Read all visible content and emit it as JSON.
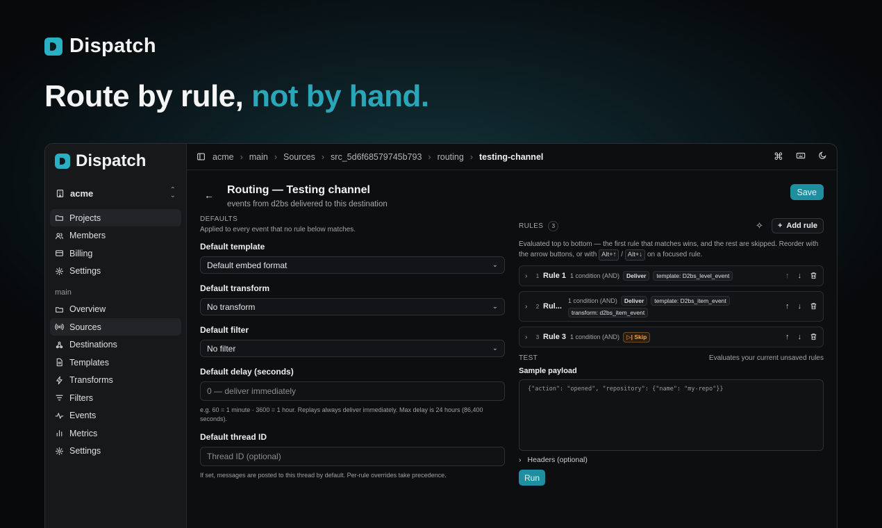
{
  "brand": {
    "name": "Dispatch"
  },
  "hero": {
    "title_main": "Route by rule, ",
    "title_accent": "not by hand."
  },
  "sidebar": {
    "org": "acme",
    "nav_top": [
      {
        "label": "Projects",
        "icon": "folder-icon",
        "active": true
      },
      {
        "label": "Members",
        "icon": "users-icon"
      },
      {
        "label": "Billing",
        "icon": "credit-card-icon"
      },
      {
        "label": "Settings",
        "icon": "gear-icon"
      }
    ],
    "section_label": "main",
    "nav_main": [
      {
        "label": "Overview",
        "icon": "folder-icon"
      },
      {
        "label": "Sources",
        "icon": "radio-icon",
        "active": true
      },
      {
        "label": "Destinations",
        "icon": "webhook-icon"
      },
      {
        "label": "Templates",
        "icon": "file-icon"
      },
      {
        "label": "Transforms",
        "icon": "bolt-icon"
      },
      {
        "label": "Filters",
        "icon": "filter-icon"
      },
      {
        "label": "Events",
        "icon": "activity-icon"
      },
      {
        "label": "Metrics",
        "icon": "bar-chart-icon"
      },
      {
        "label": "Settings",
        "icon": "gear-icon"
      }
    ]
  },
  "breadcrumbs": [
    "acme",
    "main",
    "Sources",
    "src_5d6f68579745b793",
    "routing",
    "testing-channel"
  ],
  "page": {
    "title": "Routing — Testing channel",
    "subtitle": "events from d2bs delivered to this destination",
    "save_label": "Save"
  },
  "defaults": {
    "section_label": "DEFAULTS",
    "hint": "Applied to every event that no rule below matches.",
    "template_label": "Default template",
    "template_value": "Default embed format",
    "transform_label": "Default transform",
    "transform_value": "No transform",
    "filter_label": "Default filter",
    "filter_value": "No filter",
    "delay_label": "Default delay (seconds)",
    "delay_placeholder": "0 — deliver immediately",
    "delay_hint": "e.g. 60 = 1 minute · 3600 = 1 hour. Replays always deliver immediately. Max delay is 24 hours (86,400 seconds).",
    "thread_label": "Default thread ID",
    "thread_placeholder": "Thread ID (optional)",
    "thread_hint": "If set, messages are posted to this thread by default. Per-rule overrides take precedence."
  },
  "rules": {
    "section_label": "RULES",
    "count": "3",
    "add_label": "Add rule",
    "desc_1": "Evaluated top to bottom — the first rule that matches wins, and the rest are skipped. Reorder with the arrow buttons, or with ",
    "kbd_up": "Alt+↑",
    "slash": " / ",
    "kbd_down": "Alt+↓",
    "desc_2": " on a focused rule.",
    "items": [
      {
        "index": "1",
        "name": "Rule 1",
        "condition": "1 condition (AND)",
        "action": "Deliver",
        "tags": [
          "template: D2bs_level_event"
        ]
      },
      {
        "index": "2",
        "name": "Rul...",
        "condition": "1 condition (AND)",
        "action": "Deliver",
        "tags": [
          "template: D2bs_item_event",
          "transform: d2bs_item_event"
        ]
      },
      {
        "index": "3",
        "name": "Rule 3",
        "condition": "1 condition (AND)",
        "action": "Skip",
        "tags": []
      }
    ]
  },
  "test": {
    "section_label": "TEST",
    "note": "Evaluates your current unsaved rules",
    "payload_label": "Sample payload",
    "payload_placeholder": "{\"action\": \"opened\", \"repository\": {\"name\": \"my-repo\"}}",
    "headers_label": "Headers (optional)",
    "run_label": "Run"
  },
  "colors": {
    "accent": "#2aa6b8",
    "button": "#1e8fa0",
    "skip": "#f0a54a"
  }
}
